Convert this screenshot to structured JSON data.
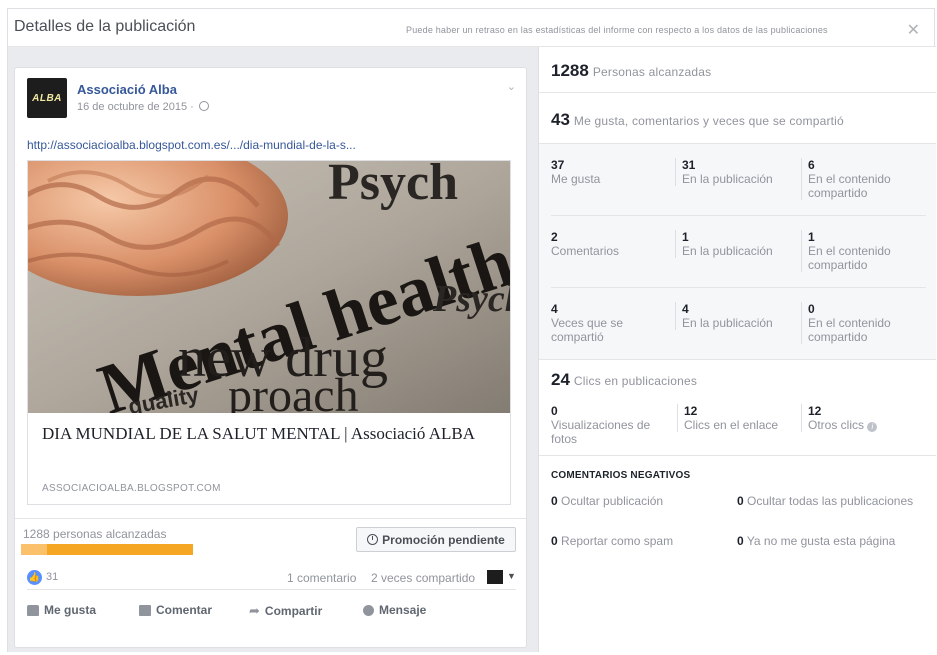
{
  "header": {
    "title": "Detalles de la publicación",
    "note": "Puede haber un retraso en las estadísticas del informe con respecto a los datos de las publicaciones",
    "close": "✕"
  },
  "post": {
    "page_name": "Associació Alba",
    "avatar_text": "ALBA",
    "date": "16 de octubre de 2015 ·",
    "link": "http://associacioalba.blogspot.com.es/.../dia-mundial-de-la-s...",
    "image_words": {
      "word1": "Mental health",
      "word2": "new drug",
      "word3": "proach",
      "word4": "Psych",
      "word5": "quality",
      "word6": "Psychi"
    },
    "share_title": "DIA MUNDIAL DE LA SALUT MENTAL | Associació ALBA",
    "share_domain": "ASSOCIACIOALBA.BLOGSPOT.COM",
    "reach_label": "1288 personas alcanzadas",
    "reach_organic_fraction": 0.15,
    "promo_button": "Promoción pendiente",
    "like_count": "31",
    "comment_count": "1 comentario",
    "share_count": "2 veces compartido",
    "actions": {
      "like": "Me gusta",
      "comment": "Comentar",
      "share": "Compartir",
      "message": "Mensaje"
    },
    "colors": {
      "link": "#365899",
      "reach_bar": "#f5a623",
      "like_badge": "#5890ff"
    }
  },
  "insights": {
    "reach": {
      "value": "1288",
      "label": "Personas alcanzadas"
    },
    "engagement": {
      "value": "43",
      "label": "Me gusta, comentarios y veces que se compartió"
    },
    "rows": [
      {
        "total": {
          "value": "37",
          "label": "Me gusta"
        },
        "on_post": {
          "value": "31",
          "label": "En la publicación"
        },
        "on_shares": {
          "value": "6",
          "label": "En el contenido compartido"
        }
      },
      {
        "total": {
          "value": "2",
          "label": "Comentarios"
        },
        "on_post": {
          "value": "1",
          "label": "En la publicación"
        },
        "on_shares": {
          "value": "1",
          "label": "En el contenido compartido"
        }
      },
      {
        "total": {
          "value": "4",
          "label": "Veces que se compartió"
        },
        "on_post": {
          "value": "4",
          "label": "En la publicación"
        },
        "on_shares": {
          "value": "0",
          "label": "En el contenido compartido"
        }
      }
    ],
    "clicks": {
      "value": "24",
      "label": "Clics en publicaciones",
      "photo_views": {
        "value": "0",
        "label": "Visualizaciones de fotos"
      },
      "link_clicks": {
        "value": "12",
        "label": "Clics en el enlace"
      },
      "other_clicks": {
        "value": "12",
        "label": "Otros clics"
      }
    },
    "negative": {
      "title": "COMENTARIOS NEGATIVOS",
      "hide_post": {
        "value": "0",
        "label": "Ocultar publicación"
      },
      "hide_all": {
        "value": "0",
        "label": "Ocultar todas las publicaciones"
      },
      "spam": {
        "value": "0",
        "label": "Reportar como spam"
      },
      "unlike_page": {
        "value": "0",
        "label": "Ya no me gusta esta página"
      }
    }
  }
}
